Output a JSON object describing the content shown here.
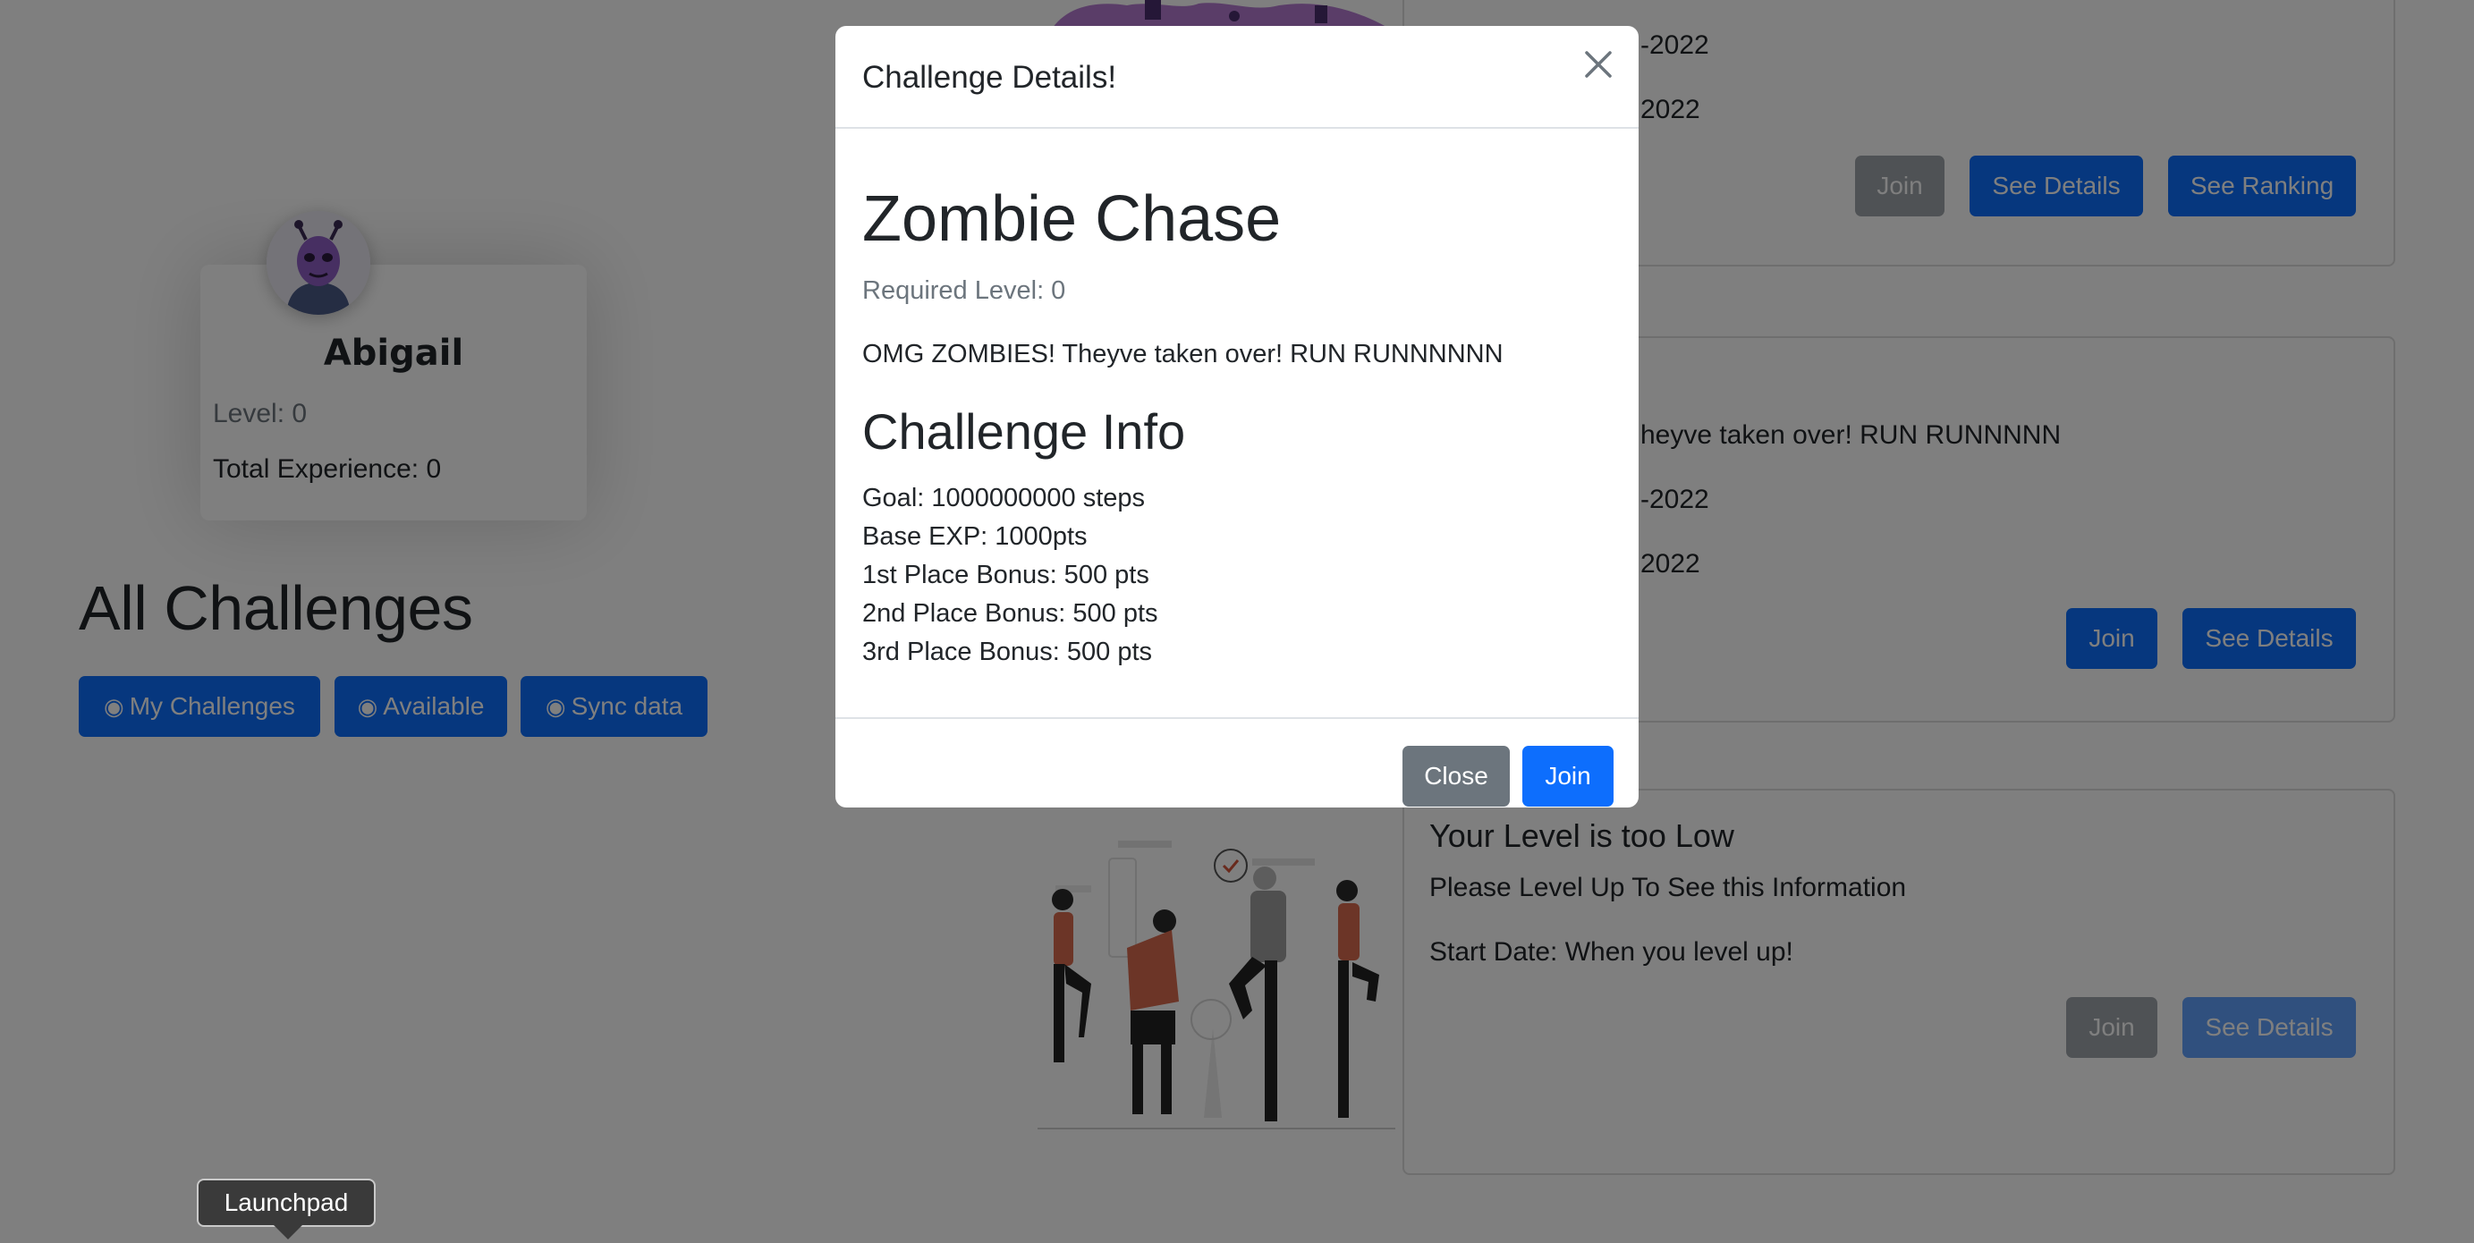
{
  "profile": {
    "name": "Abigail",
    "level_text": "Level: 0",
    "experience_text": "Total Experience: 0"
  },
  "challenges_section": {
    "title": "All Challenges",
    "buttons": {
      "my_challenges": "My Challenges",
      "available": "Available",
      "sync_data": "Sync data"
    },
    "button_icon": "target-icon"
  },
  "cards": [
    {
      "lines": [
        "-2022",
        "2022"
      ],
      "buttons": {
        "join": "Join",
        "details": "See Details",
        "ranking": "See Ranking"
      }
    },
    {
      "lines": [
        "heyve taken over! RUN RUNNNNN",
        "-2022",
        "2022"
      ],
      "buttons": {
        "join": "Join",
        "details": "See Details"
      }
    },
    {
      "title": "Your Level is too Low",
      "lines": [
        "Please Level Up To See this Information",
        "Start Date: When you level up!"
      ],
      "buttons": {
        "join": "Join",
        "details": "See Details"
      }
    }
  ],
  "modal": {
    "title": "Challenge Details!",
    "challenge_name": "Zombie Chase",
    "required_level": "Required Level: 0",
    "description": "OMG ZOMBIES! Theyve taken over! RUN RUNNNNNN",
    "info_title": "Challenge Info",
    "info": [
      "Goal: 1000000000 steps",
      "Base EXP: 1000pts",
      "1st Place Bonus: 500 pts",
      "2nd Place Bonus: 500 pts",
      "3rd Place Bonus: 500 pts"
    ],
    "close_label": "Close",
    "join_label": "Join"
  },
  "tooltip": {
    "label": "Launchpad"
  },
  "colors": {
    "primary": "#0d6efd",
    "secondary": "#6c757d",
    "backdrop": "rgba(0,0,0,0.5)"
  }
}
